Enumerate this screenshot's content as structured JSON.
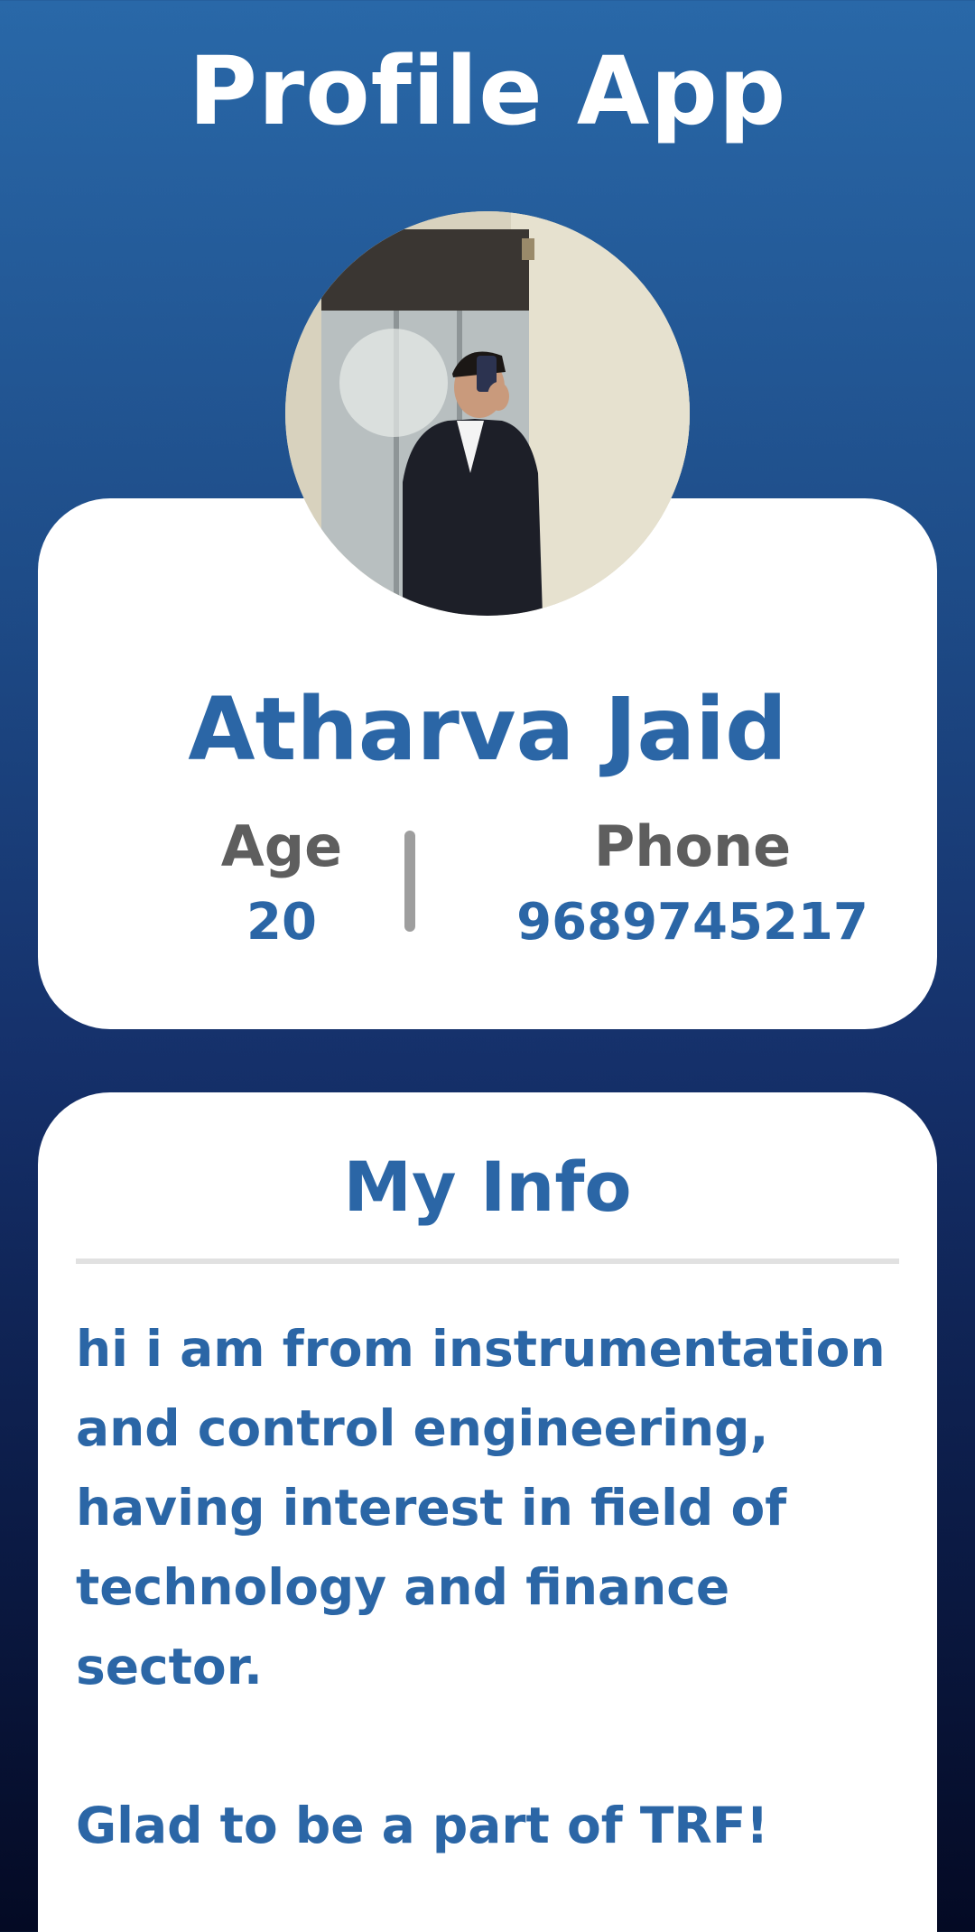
{
  "header": {
    "title": "Profile App"
  },
  "profile": {
    "avatar_icon": "profile-photo",
    "name": "Atharva Jaid",
    "age_label": "Age",
    "age_value": "20",
    "phone_label": "Phone",
    "phone_value": "9689745217"
  },
  "info": {
    "title": "My Info",
    "bio": "hi i am from instrumentation\nand control engineering,\nhaving interest in field of\ntechnology and finance sector.\n\nGlad to be a part of TRF!"
  },
  "colors": {
    "accent": "#2b66a6",
    "label_gray": "#5e5e5e",
    "gradient_top": "#2968a8",
    "gradient_bottom": "#040a24"
  }
}
